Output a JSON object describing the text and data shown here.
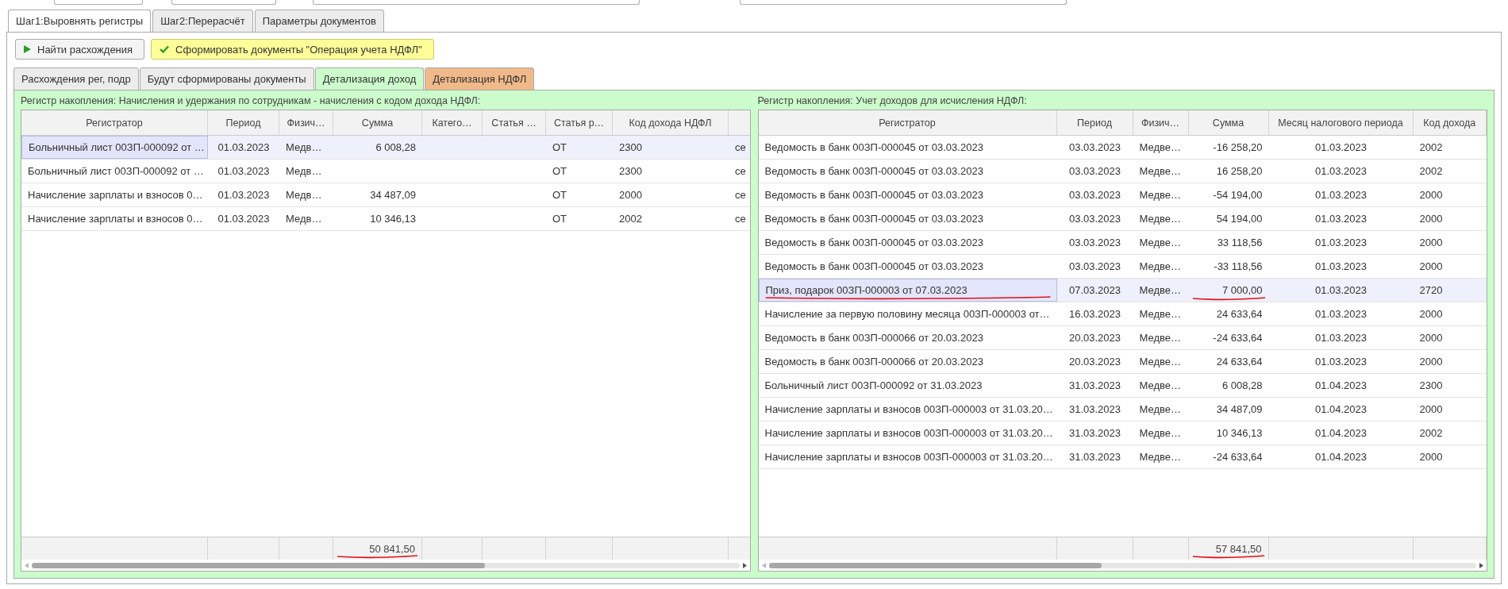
{
  "top_tabs": [
    {
      "label": "Шаг1:Выровнять регистры",
      "selected": true
    },
    {
      "label": "Шаг2:Перерасчёт",
      "selected": false
    },
    {
      "label": "Параметры документов",
      "selected": false
    }
  ],
  "buttons": [
    {
      "kind": "play",
      "label": "Найти расхождения"
    },
    {
      "kind": "check",
      "label": "Сформировать документы \"Операция учета НДФЛ\""
    }
  ],
  "sub_tabs": [
    {
      "label": "Расхождения рег, подр",
      "selected": false,
      "color": "#ececec"
    },
    {
      "label": "Будут сформированы документы",
      "selected": false,
      "color": "#ececec"
    },
    {
      "label": "Детализация доход",
      "selected": true,
      "color": "#ccfccc"
    },
    {
      "label": "Детализация НДФЛ",
      "selected": false,
      "color": "#f0b98a"
    }
  ],
  "left_table": {
    "caption": "Регистр накопления: Начисления и удержания по сотрудникам - начисления с кодом дохода НДФЛ:",
    "columns": [
      "Регистратор",
      "Период",
      "Физич…",
      "Сумма",
      "Катего…",
      "Статья …",
      "Статья р…",
      "Код дохода НДФЛ",
      ""
    ],
    "rows": [
      {
        "selected": true,
        "cells": [
          "Больничный лист 00ЗП-000092 от …",
          "01.03.2023",
          "Медв…",
          "6 008,28",
          "",
          "",
          "ОТ",
          "2300",
          "се"
        ]
      },
      {
        "selected": false,
        "cells": [
          "Больничный лист 00ЗП-000092 от …",
          "01.03.2023",
          "Медв…",
          "",
          "",
          "",
          "ОТ",
          "2300",
          "се"
        ]
      },
      {
        "selected": false,
        "cells": [
          "Начисление зарплаты и взносов 0…",
          "01.03.2023",
          "Медв…",
          "34 487,09",
          "",
          "",
          "ОТ",
          "2000",
          "се"
        ]
      },
      {
        "selected": false,
        "cells": [
          "Начисление зарплаты и взносов 0…",
          "01.03.2023",
          "Медв…",
          "10 346,13",
          "",
          "",
          "ОТ",
          "2002",
          "се"
        ]
      }
    ],
    "total": {
      "text": "50 841,50",
      "underlined": true
    }
  },
  "right_table": {
    "caption": "Регистр накопления: Учет доходов для исчисления НДФЛ:",
    "columns": [
      "Регистратор",
      "Период",
      "Физич…",
      "Сумма",
      "Месяц налогового периода",
      "Код дохода"
    ],
    "rows": [
      {
        "selected": false,
        "underlined": false,
        "cells": [
          "Ведомость в банк 00ЗП-000045 от 03.03.2023",
          "03.03.2023",
          "Медве…",
          "-16 258,20",
          "01.03.2023",
          "2002"
        ]
      },
      {
        "selected": false,
        "underlined": false,
        "cells": [
          "Ведомость в банк 00ЗП-000045 от 03.03.2023",
          "03.03.2023",
          "Медве…",
          "16 258,20",
          "01.03.2023",
          "2002"
        ]
      },
      {
        "selected": false,
        "underlined": false,
        "cells": [
          "Ведомость в банк 00ЗП-000045 от 03.03.2023",
          "03.03.2023",
          "Медве…",
          "-54 194,00",
          "01.03.2023",
          "2000"
        ]
      },
      {
        "selected": false,
        "underlined": false,
        "cells": [
          "Ведомость в банк 00ЗП-000045 от 03.03.2023",
          "03.03.2023",
          "Медве…",
          "54 194,00",
          "01.03.2023",
          "2000"
        ]
      },
      {
        "selected": false,
        "underlined": false,
        "cells": [
          "Ведомость в банк 00ЗП-000045 от 03.03.2023",
          "03.03.2023",
          "Медве…",
          "33 118,56",
          "01.03.2023",
          "2000"
        ]
      },
      {
        "selected": false,
        "underlined": false,
        "cells": [
          "Ведомость в банк 00ЗП-000045 от 03.03.2023",
          "03.03.2023",
          "Медве…",
          "-33 118,56",
          "01.03.2023",
          "2000"
        ]
      },
      {
        "selected": true,
        "underlined": true,
        "cells": [
          "Приз, подарок 00ЗП-000003 от 07.03.2023",
          "07.03.2023",
          "Медве…",
          "7 000,00",
          "01.03.2023",
          "2720"
        ]
      },
      {
        "selected": false,
        "underlined": false,
        "cells": [
          "Начисление за первую половину месяца 00ЗП-000003 от…",
          "16.03.2023",
          "Медве…",
          "24 633,64",
          "01.03.2023",
          "2000"
        ]
      },
      {
        "selected": false,
        "underlined": false,
        "cells": [
          "Ведомость в банк 00ЗП-000066 от 20.03.2023",
          "20.03.2023",
          "Медве…",
          "-24 633,64",
          "01.03.2023",
          "2000"
        ]
      },
      {
        "selected": false,
        "underlined": false,
        "cells": [
          "Ведомость в банк 00ЗП-000066 от 20.03.2023",
          "20.03.2023",
          "Медве…",
          "24 633,64",
          "01.03.2023",
          "2000"
        ]
      },
      {
        "selected": false,
        "underlined": false,
        "cells": [
          "Больничный лист 00ЗП-000092 от 31.03.2023",
          "31.03.2023",
          "Медве…",
          "6 008,28",
          "01.04.2023",
          "2300"
        ]
      },
      {
        "selected": false,
        "underlined": false,
        "cells": [
          "Начисление зарплаты и взносов 00ЗП-000003 от 31.03.20…",
          "31.03.2023",
          "Медве…",
          "34 487,09",
          "01.04.2023",
          "2000"
        ]
      },
      {
        "selected": false,
        "underlined": false,
        "cells": [
          "Начисление зарплаты и взносов 00ЗП-000003 от 31.03.20…",
          "31.03.2023",
          "Медве…",
          "10 346,13",
          "01.04.2023",
          "2002"
        ]
      },
      {
        "selected": false,
        "underlined": false,
        "cells": [
          "Начисление зарплаты и взносов 00ЗП-000003 от 31.03.20…",
          "31.03.2023",
          "Медве…",
          "-24 633,64",
          "01.04.2023",
          "2000"
        ]
      }
    ],
    "total": {
      "text": "57 841,50",
      "underlined": true
    }
  }
}
